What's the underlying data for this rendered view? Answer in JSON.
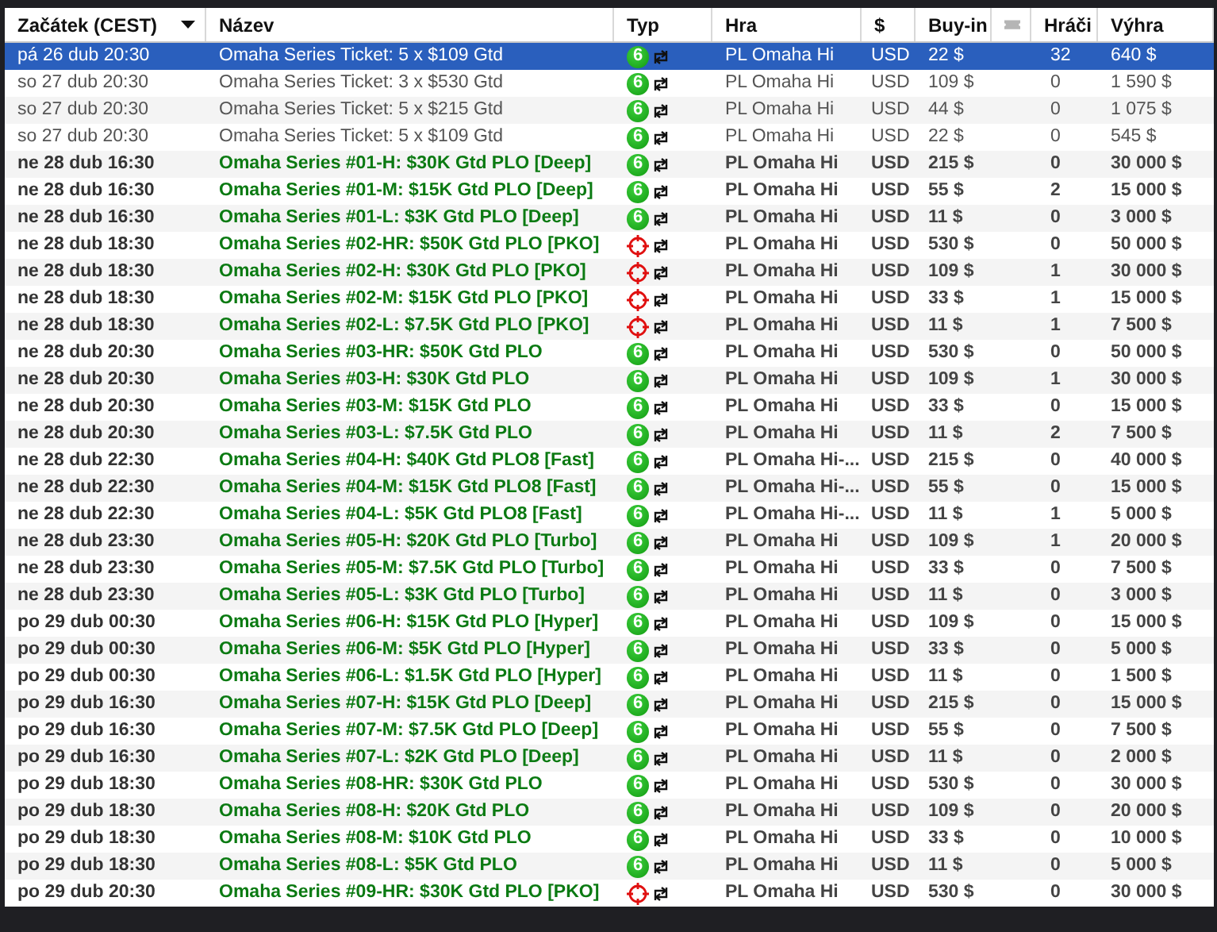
{
  "table": {
    "columns": [
      {
        "label": "Začátek (CEST)",
        "sorted": true
      },
      {
        "label": "Název"
      },
      {
        "label": "Typ"
      },
      {
        "label": "Hra"
      },
      {
        "label": "$"
      },
      {
        "label": "Buy-in"
      },
      {
        "kind": "ticket"
      },
      {
        "label": "Hráči"
      },
      {
        "label": "Výhra"
      }
    ],
    "rows": [
      {
        "kind": "ticket",
        "selected": true,
        "start": "pá 26 dub 20:30",
        "name": "Omaha Series Ticket: 5 x $109 Gtd",
        "type": {
          "kind": "six",
          "badge": "6"
        },
        "game": "PL Omaha Hi",
        "currency": "USD",
        "buy_in": "22 $",
        "players": "32",
        "prize": "640 $"
      },
      {
        "kind": "ticket",
        "selected": false,
        "start": "so 27 dub 20:30",
        "name": "Omaha Series Ticket: 3 x $530 Gtd",
        "type": {
          "kind": "six",
          "badge": "6"
        },
        "game": "PL Omaha Hi",
        "currency": "USD",
        "buy_in": "109 $",
        "players": "0",
        "prize": "1 590 $"
      },
      {
        "kind": "ticket",
        "selected": false,
        "start": "so 27 dub 20:30",
        "name": "Omaha Series Ticket: 5 x $215 Gtd",
        "type": {
          "kind": "six",
          "badge": "6"
        },
        "game": "PL Omaha Hi",
        "currency": "USD",
        "buy_in": "44 $",
        "players": "0",
        "prize": "1 075 $"
      },
      {
        "kind": "ticket",
        "selected": false,
        "start": "so 27 dub 20:30",
        "name": "Omaha Series Ticket: 5 x $109 Gtd",
        "type": {
          "kind": "six",
          "badge": "6"
        },
        "game": "PL Omaha Hi",
        "currency": "USD",
        "buy_in": "22 $",
        "players": "0",
        "prize": "545 $"
      },
      {
        "kind": "event",
        "selected": false,
        "start": "ne 28 dub 16:30",
        "name": "Omaha Series #01-H: $30K Gtd PLO [Deep]",
        "type": {
          "kind": "six",
          "badge": "6"
        },
        "game": "PL Omaha Hi",
        "currency": "USD",
        "buy_in": "215 $",
        "players": "0",
        "prize": "30 000 $"
      },
      {
        "kind": "event",
        "selected": false,
        "start": "ne 28 dub 16:30",
        "name": "Omaha Series #01-M: $15K Gtd PLO [Deep]",
        "type": {
          "kind": "six",
          "badge": "6"
        },
        "game": "PL Omaha Hi",
        "currency": "USD",
        "buy_in": "55 $",
        "players": "2",
        "prize": "15 000 $"
      },
      {
        "kind": "event",
        "selected": false,
        "start": "ne 28 dub 16:30",
        "name": "Omaha Series #01-L: $3K Gtd PLO [Deep]",
        "type": {
          "kind": "six",
          "badge": "6"
        },
        "game": "PL Omaha Hi",
        "currency": "USD",
        "buy_in": "11 $",
        "players": "0",
        "prize": "3 000 $"
      },
      {
        "kind": "event",
        "selected": false,
        "start": "ne 28 dub 18:30",
        "name": "Omaha Series #02-HR: $50K Gtd PLO [PKO]",
        "type": {
          "kind": "target"
        },
        "game": "PL Omaha Hi",
        "currency": "USD",
        "buy_in": "530 $",
        "players": "0",
        "prize": "50 000 $"
      },
      {
        "kind": "event",
        "selected": false,
        "start": "ne 28 dub 18:30",
        "name": "Omaha Series #02-H: $30K Gtd PLO [PKO]",
        "type": {
          "kind": "target"
        },
        "game": "PL Omaha Hi",
        "currency": "USD",
        "buy_in": "109 $",
        "players": "1",
        "prize": "30 000 $"
      },
      {
        "kind": "event",
        "selected": false,
        "start": "ne 28 dub 18:30",
        "name": "Omaha Series #02-M: $15K Gtd PLO [PKO]",
        "type": {
          "kind": "target"
        },
        "game": "PL Omaha Hi",
        "currency": "USD",
        "buy_in": "33 $",
        "players": "1",
        "prize": "15 000 $"
      },
      {
        "kind": "event",
        "selected": false,
        "start": "ne 28 dub 18:30",
        "name": "Omaha Series #02-L: $7.5K Gtd PLO [PKO]",
        "type": {
          "kind": "target"
        },
        "game": "PL Omaha Hi",
        "currency": "USD",
        "buy_in": "11 $",
        "players": "1",
        "prize": "7 500 $"
      },
      {
        "kind": "event",
        "selected": false,
        "start": "ne 28 dub 20:30",
        "name": "Omaha Series #03-HR: $50K Gtd PLO",
        "type": {
          "kind": "six",
          "badge": "6"
        },
        "game": "PL Omaha Hi",
        "currency": "USD",
        "buy_in": "530 $",
        "players": "0",
        "prize": "50 000 $"
      },
      {
        "kind": "event",
        "selected": false,
        "start": "ne 28 dub 20:30",
        "name": "Omaha Series #03-H: $30K Gtd PLO",
        "type": {
          "kind": "six",
          "badge": "6"
        },
        "game": "PL Omaha Hi",
        "currency": "USD",
        "buy_in": "109 $",
        "players": "1",
        "prize": "30 000 $"
      },
      {
        "kind": "event",
        "selected": false,
        "start": "ne 28 dub 20:30",
        "name": "Omaha Series #03-M: $15K Gtd PLO",
        "type": {
          "kind": "six",
          "badge": "6"
        },
        "game": "PL Omaha Hi",
        "currency": "USD",
        "buy_in": "33 $",
        "players": "0",
        "prize": "15 000 $"
      },
      {
        "kind": "event",
        "selected": false,
        "start": "ne 28 dub 20:30",
        "name": "Omaha Series #03-L: $7.5K Gtd PLO",
        "type": {
          "kind": "six",
          "badge": "6"
        },
        "game": "PL Omaha Hi",
        "currency": "USD",
        "buy_in": "11 $",
        "players": "2",
        "prize": "7 500 $"
      },
      {
        "kind": "event",
        "selected": false,
        "start": "ne 28 dub 22:30",
        "name": "Omaha Series #04-H: $40K Gtd PLO8 [Fast]",
        "type": {
          "kind": "six",
          "badge": "6"
        },
        "game": "PL Omaha Hi-...",
        "currency": "USD",
        "buy_in": "215 $",
        "players": "0",
        "prize": "40 000 $"
      },
      {
        "kind": "event",
        "selected": false,
        "start": "ne 28 dub 22:30",
        "name": "Omaha Series #04-M: $15K Gtd PLO8 [Fast]",
        "type": {
          "kind": "six",
          "badge": "6"
        },
        "game": "PL Omaha Hi-...",
        "currency": "USD",
        "buy_in": "55 $",
        "players": "0",
        "prize": "15 000 $"
      },
      {
        "kind": "event",
        "selected": false,
        "start": "ne 28 dub 22:30",
        "name": "Omaha Series #04-L: $5K Gtd PLO8 [Fast]",
        "type": {
          "kind": "six",
          "badge": "6"
        },
        "game": "PL Omaha Hi-...",
        "currency": "USD",
        "buy_in": "11 $",
        "players": "1",
        "prize": "5 000 $"
      },
      {
        "kind": "event",
        "selected": false,
        "start": "ne 28 dub 23:30",
        "name": "Omaha Series #05-H: $20K Gtd PLO [Turbo]",
        "type": {
          "kind": "six",
          "badge": "6"
        },
        "game": "PL Omaha Hi",
        "currency": "USD",
        "buy_in": "109 $",
        "players": "1",
        "prize": "20 000 $"
      },
      {
        "kind": "event",
        "selected": false,
        "start": "ne 28 dub 23:30",
        "name": "Omaha Series #05-M: $7.5K Gtd PLO [Turbo]",
        "type": {
          "kind": "six",
          "badge": "6"
        },
        "game": "PL Omaha Hi",
        "currency": "USD",
        "buy_in": "33 $",
        "players": "0",
        "prize": "7 500 $"
      },
      {
        "kind": "event",
        "selected": false,
        "start": "ne 28 dub 23:30",
        "name": "Omaha Series #05-L: $3K Gtd PLO [Turbo]",
        "type": {
          "kind": "six",
          "badge": "6"
        },
        "game": "PL Omaha Hi",
        "currency": "USD",
        "buy_in": "11 $",
        "players": "0",
        "prize": "3 000 $"
      },
      {
        "kind": "event",
        "selected": false,
        "start": "po 29 dub 00:30",
        "name": "Omaha Series #06-H: $15K Gtd PLO [Hyper]",
        "type": {
          "kind": "six",
          "badge": "6"
        },
        "game": "PL Omaha Hi",
        "currency": "USD",
        "buy_in": "109 $",
        "players": "0",
        "prize": "15 000 $"
      },
      {
        "kind": "event",
        "selected": false,
        "start": "po 29 dub 00:30",
        "name": "Omaha Series #06-M: $5K Gtd PLO [Hyper]",
        "type": {
          "kind": "six",
          "badge": "6"
        },
        "game": "PL Omaha Hi",
        "currency": "USD",
        "buy_in": "33 $",
        "players": "0",
        "prize": "5 000 $"
      },
      {
        "kind": "event",
        "selected": false,
        "start": "po 29 dub 00:30",
        "name": "Omaha Series #06-L: $1.5K Gtd PLO [Hyper]",
        "type": {
          "kind": "six",
          "badge": "6"
        },
        "game": "PL Omaha Hi",
        "currency": "USD",
        "buy_in": "11 $",
        "players": "0",
        "prize": "1 500 $"
      },
      {
        "kind": "event",
        "selected": false,
        "start": "po 29 dub 16:30",
        "name": "Omaha Series #07-H: $15K Gtd PLO [Deep]",
        "type": {
          "kind": "six",
          "badge": "6"
        },
        "game": "PL Omaha Hi",
        "currency": "USD",
        "buy_in": "215 $",
        "players": "0",
        "prize": "15 000 $"
      },
      {
        "kind": "event",
        "selected": false,
        "start": "po 29 dub 16:30",
        "name": "Omaha Series #07-M: $7.5K Gtd PLO [Deep]",
        "type": {
          "kind": "six",
          "badge": "6"
        },
        "game": "PL Omaha Hi",
        "currency": "USD",
        "buy_in": "55 $",
        "players": "0",
        "prize": "7 500 $"
      },
      {
        "kind": "event",
        "selected": false,
        "start": "po 29 dub 16:30",
        "name": "Omaha Series #07-L: $2K Gtd PLO [Deep]",
        "type": {
          "kind": "six",
          "badge": "6"
        },
        "game": "PL Omaha Hi",
        "currency": "USD",
        "buy_in": "11 $",
        "players": "0",
        "prize": "2 000 $"
      },
      {
        "kind": "event",
        "selected": false,
        "start": "po 29 dub 18:30",
        "name": "Omaha Series #08-HR: $30K Gtd PLO",
        "type": {
          "kind": "six",
          "badge": "6"
        },
        "game": "PL Omaha Hi",
        "currency": "USD",
        "buy_in": "530 $",
        "players": "0",
        "prize": "30 000 $"
      },
      {
        "kind": "event",
        "selected": false,
        "start": "po 29 dub 18:30",
        "name": "Omaha Series #08-H: $20K Gtd PLO",
        "type": {
          "kind": "six",
          "badge": "6"
        },
        "game": "PL Omaha Hi",
        "currency": "USD",
        "buy_in": "109 $",
        "players": "0",
        "prize": "20 000 $"
      },
      {
        "kind": "event",
        "selected": false,
        "start": "po 29 dub 18:30",
        "name": "Omaha Series #08-M: $10K Gtd PLO",
        "type": {
          "kind": "six",
          "badge": "6"
        },
        "game": "PL Omaha Hi",
        "currency": "USD",
        "buy_in": "33 $",
        "players": "0",
        "prize": "10 000 $"
      },
      {
        "kind": "event",
        "selected": false,
        "start": "po 29 dub 18:30",
        "name": "Omaha Series #08-L: $5K Gtd PLO",
        "type": {
          "kind": "six",
          "badge": "6"
        },
        "game": "PL Omaha Hi",
        "currency": "USD",
        "buy_in": "11 $",
        "players": "0",
        "prize": "5 000 $"
      },
      {
        "kind": "event",
        "selected": false,
        "start": "po 29 dub 20:30",
        "name": "Omaha Series #09-HR: $30K Gtd PLO [PKO]",
        "type": {
          "kind": "target"
        },
        "game": "PL Omaha Hi",
        "currency": "USD",
        "buy_in": "530 $",
        "players": "0",
        "prize": "30 000 $"
      }
    ]
  }
}
